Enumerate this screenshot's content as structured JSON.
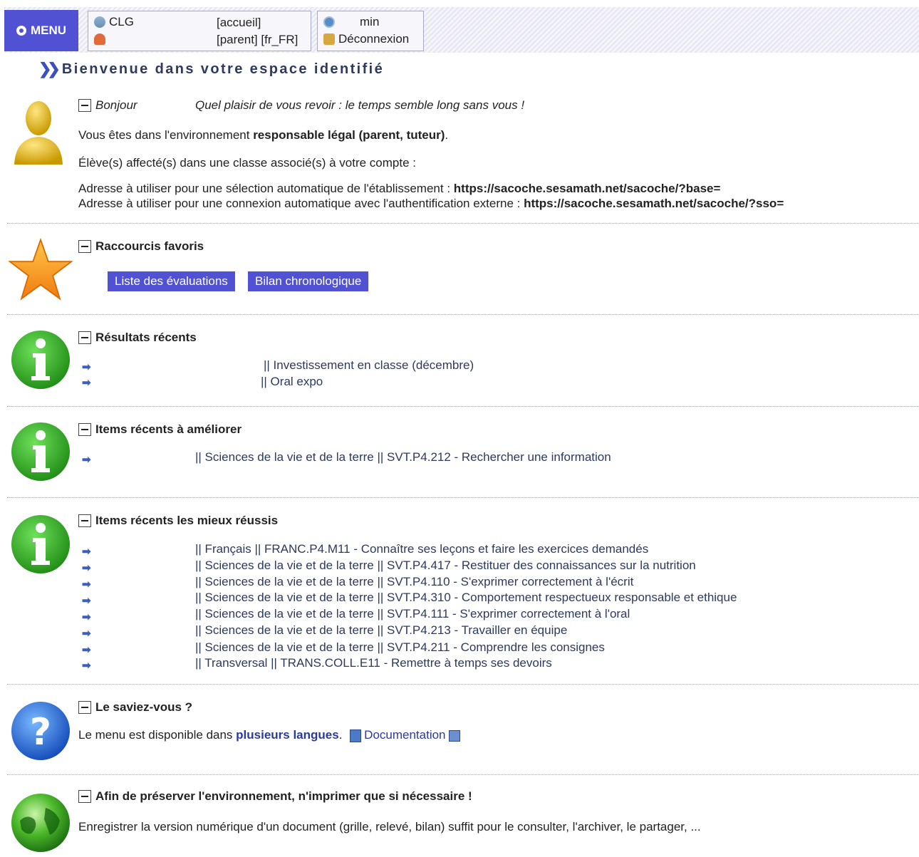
{
  "topbar": {
    "menu_label": "MENU",
    "school": "CLG",
    "page": "[accueil]",
    "profile": "[parent] [fr_FR]",
    "timer": "min",
    "logout": "Déconnexion"
  },
  "welcome": "Bienvenue dans votre espace identifié",
  "bonjour": {
    "title": "Bonjour",
    "message": "Quel plaisir de vous revoir : le temps semble long sans vous !",
    "env_prefix": "Vous êtes dans l'environnement ",
    "env_bold": "responsable légal (parent, tuteur)",
    "env_suffix": ".",
    "students": "Élève(s) affecté(s) dans une classe associé(s) à votre compte :",
    "addr1_prefix": "Adresse à utiliser pour une sélection automatique de l'établissement : ",
    "addr1_url": "https://sacoche.sesamath.net/sacoche/?base=",
    "addr2_prefix": "Adresse à utiliser pour une connexion automatique avec l'authentification externe : ",
    "addr2_url": "https://sacoche.sesamath.net/sacoche/?sso="
  },
  "favoris": {
    "title": "Raccourcis favoris",
    "buttons": [
      "Liste des évaluations",
      "Bilan chronologique"
    ]
  },
  "resultats": {
    "title": "Résultats récents",
    "items": [
      "|| Investissement en classe (décembre)",
      "|| Oral expo"
    ]
  },
  "ameliorer": {
    "title": "Items récents à améliorer",
    "items": [
      "|| Sciences de la vie et de la terre || SVT.P4.212 - Rechercher une information"
    ]
  },
  "reussis": {
    "title": "Items récents les mieux réussis",
    "items": [
      "|| Français || FRANC.P4.M11 - Connaître ses leçons et faire les exercices demandés",
      "|| Sciences de la vie et de la terre || SVT.P4.417 - Restituer des connaissances sur la nutrition",
      "|| Sciences de la vie et de la terre || SVT.P4.110 - S'exprimer correctement à l'écrit",
      "|| Sciences de la vie et de la terre || SVT.P4.310 - Comportement respectueux responsable et ethique",
      "|| Sciences de la vie et de la terre || SVT.P4.111 - S'exprimer correctement à l'oral",
      "|| Sciences de la vie et de la terre || SVT.P4.213 - Travailler en équipe",
      "|| Sciences de la vie et de la terre || SVT.P4.211 - Comprendre les consignes",
      "|| Transversal || TRANS.COLL.E11 - Remettre à temps ses devoirs"
    ]
  },
  "saviez": {
    "title": "Le saviez-vous ?",
    "prefix": "Le menu est disponible dans ",
    "link": "plusieurs langues",
    "suffix": ".",
    "doc": "Documentation"
  },
  "environnement": {
    "title": "Afin de préserver l'environnement, n'imprimer que si nécessaire !",
    "text": "Enregistrer la version numérique d'un document (grille, relevé, bilan) suffit pour le consulter, l'archiver, le partager, ..."
  }
}
